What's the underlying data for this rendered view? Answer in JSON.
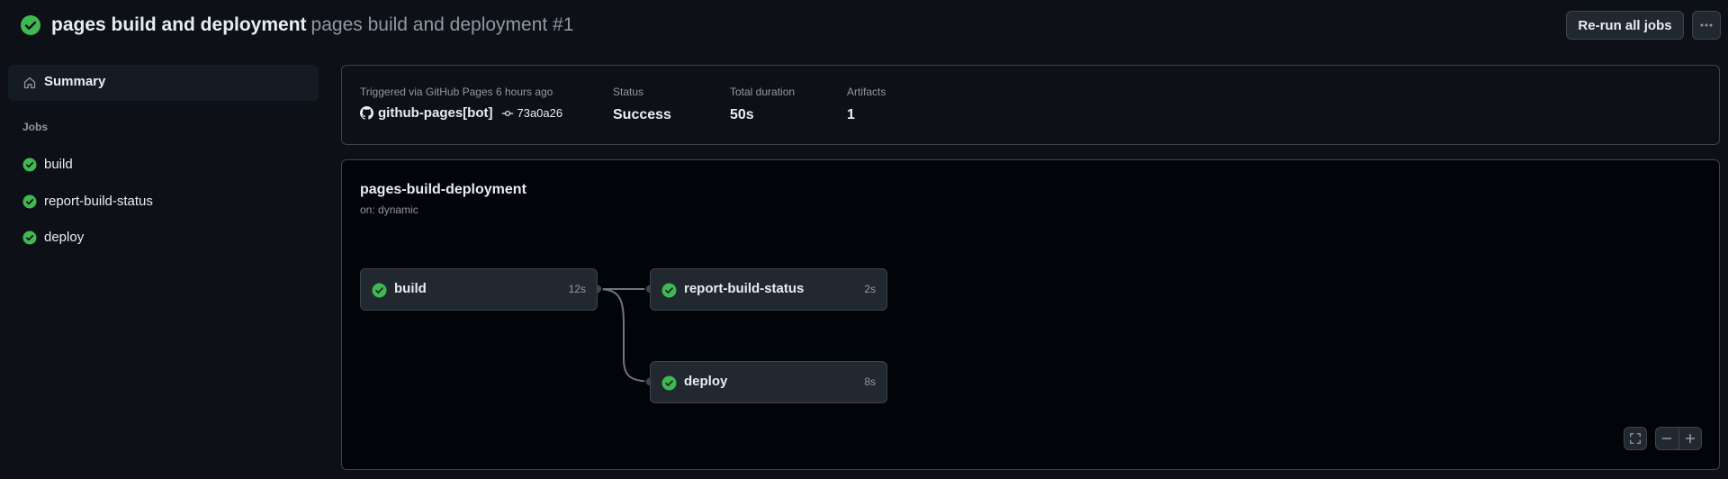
{
  "header": {
    "title": "pages build and deployment",
    "subtitle": "pages build and deployment #1",
    "rerun_label": "Re-run all jobs",
    "more_label": "···"
  },
  "sidebar": {
    "summary_label": "Summary",
    "jobs_heading": "Jobs",
    "jobs": [
      {
        "label": "build"
      },
      {
        "label": "report-build-status"
      },
      {
        "label": "deploy"
      }
    ]
  },
  "summary": {
    "triggered_text": "Triggered via GitHub Pages 6 hours ago",
    "actor": "github-pages[bot]",
    "commit": "73a0a26",
    "status_label": "Status",
    "status_value": "Success",
    "duration_label": "Total duration",
    "duration_value": "50s",
    "artifacts_label": "Artifacts",
    "artifacts_value": "1"
  },
  "graph": {
    "workflow_name": "pages-build-deployment",
    "trigger": "on: dynamic",
    "nodes": [
      {
        "name": "build",
        "duration": "12s"
      },
      {
        "name": "report-build-status",
        "duration": "2s"
      },
      {
        "name": "deploy",
        "duration": "8s"
      }
    ]
  },
  "colors": {
    "success": "#3fb950",
    "background": "#0d1117",
    "border": "#3d444d"
  }
}
